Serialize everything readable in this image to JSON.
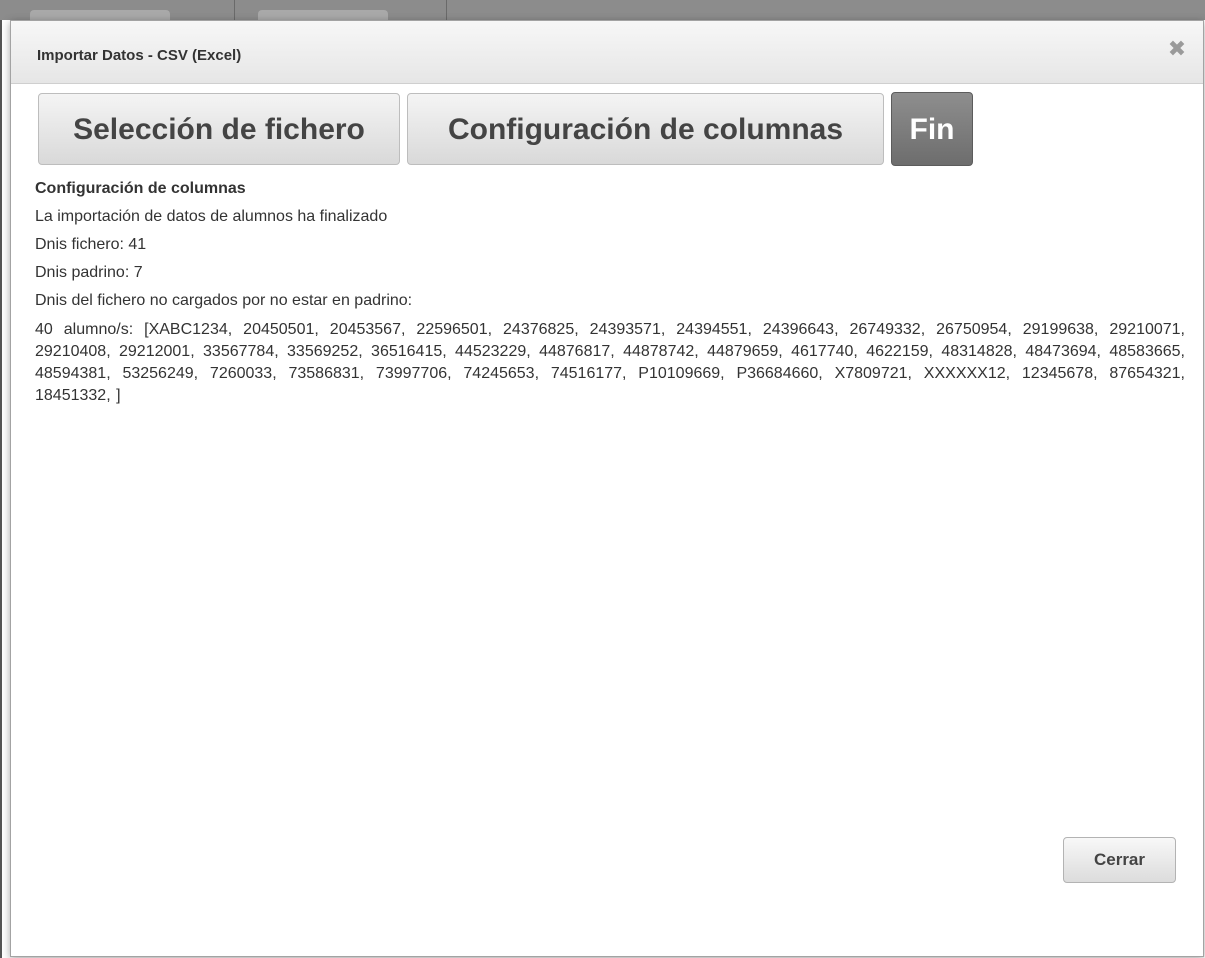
{
  "dialog": {
    "title": "Importar Datos - CSV (Excel)",
    "close_icon": "close-icon"
  },
  "steps": [
    {
      "label": "Selección de fichero"
    },
    {
      "label": "Configuración de columnas"
    },
    {
      "label": "Fin",
      "active": true
    }
  ],
  "content": {
    "section_title": "Configuración de columnas",
    "finished_message": "La importación de datos de alumnos ha finalizado",
    "dnis_fichero": "Dnis fichero: 41",
    "dnis_padrino": "Dnis padrino: 7",
    "not_loaded_label": "Dnis del fichero no cargados por no estar en padrino:",
    "not_loaded_list": "40 alumno/s: [XABC1234, 20450501, 20453567, 22596501, 24376825, 24393571, 24394551, 24396643, 26749332, 26750954, 29199638, 29210071, 29210408, 29212001, 33567784, 33569252, 36516415, 44523229, 44876817, 44878742, 44879659, 4617740, 4622159, 48314828, 48473694, 48583665, 48594381, 53256249, 7260033, 73586831, 73997706, 74245653, 74516177, P10109669, P36684660, X7809721, XXXXXX12, 12345678, 87654321, 18451332, ]"
  },
  "footer": {
    "close_label": "Cerrar"
  },
  "colors": {
    "active_step": "#7a7a7a",
    "step_background": "#e6e6e6",
    "text": "#333333"
  }
}
